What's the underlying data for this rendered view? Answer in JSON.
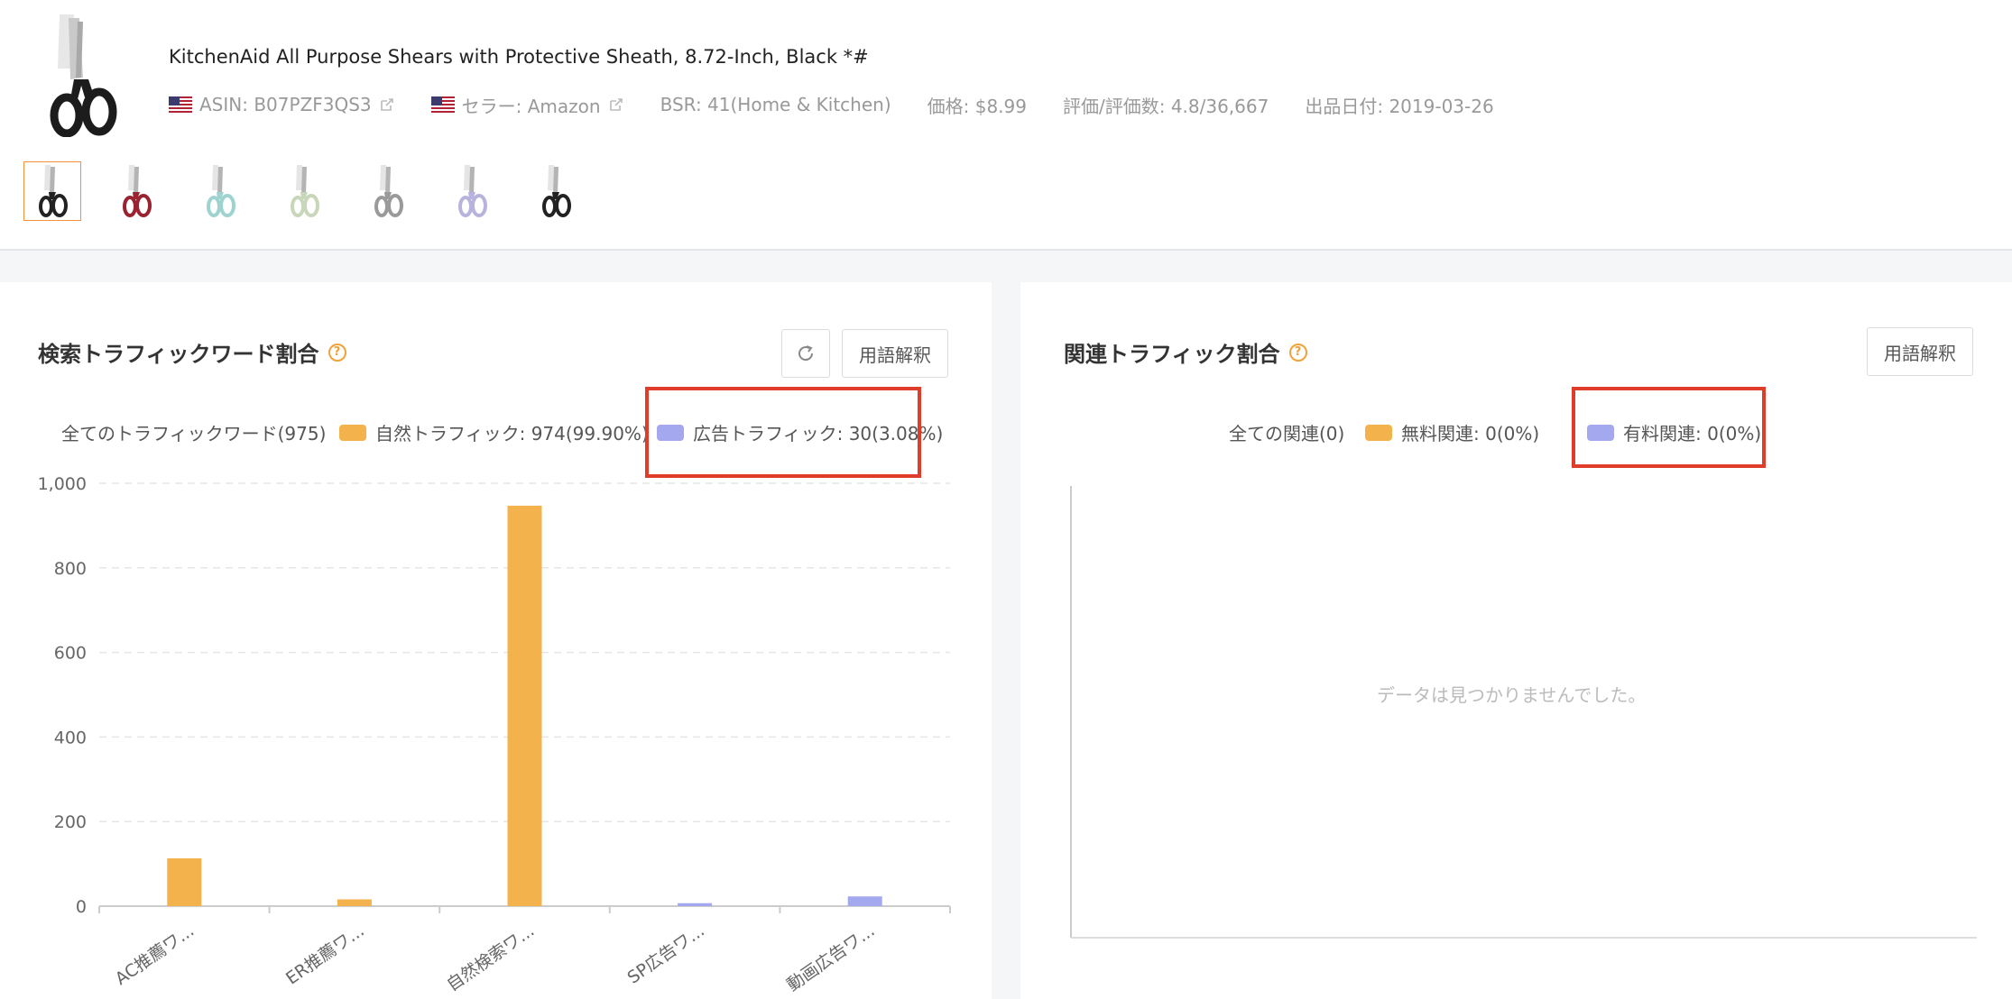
{
  "product": {
    "title": "KitchenAid All Purpose Shears with Protective Sheath, 8.72-Inch, Black *#",
    "asin": "ASIN: B07PZF3QS3",
    "seller": "セラー: Amazon",
    "bsr": "BSR: 41(Home & Kitchen)",
    "price": "価格: $8.99",
    "rating": "評価/評価数: 4.8/36,667",
    "listing_date": "出品日付: 2019-03-26",
    "thumbnail_handle_colors": [
      "#222222",
      "#9b2230",
      "#9fd3cf",
      "#c8d6b9",
      "#9a9a9a",
      "#b7b3dc",
      "#222222"
    ]
  },
  "left_panel": {
    "title": "検索トラフィックワード割合",
    "refresh_icon": "refresh-icon",
    "glossary_label": "用語解釈",
    "legend_all": "全てのトラフィックワード(975)",
    "legend_organic": "自然トラフィック: 974(99.90%)",
    "legend_ads": "広告トラフィック: 30(3.08%)"
  },
  "right_panel": {
    "title": "関連トラフィック割合",
    "glossary_label": "用語解釈",
    "legend_all": "全ての関連(0)",
    "legend_free": "無料関連: 0(0%)",
    "legend_paid": "有料関連: 0(0%)",
    "empty_message": "データは見つかりませんでした。"
  },
  "colors": {
    "organic": "#f3b24b",
    "ads": "#a3a8ef",
    "highlight": "#e03c2a",
    "accent": "#f0a23a"
  },
  "chart_data": {
    "type": "bar",
    "categories": [
      "AC推薦ワ...",
      "ER推薦ワ...",
      "自然検索ワ...",
      "SP広告ワ...",
      "動画広告ワ..."
    ],
    "series": [
      {
        "name": "自然トラフィック",
        "values": [
          113,
          16,
          947,
          0,
          0
        ],
        "color": "#f3b24b"
      },
      {
        "name": "広告トラフィック",
        "values": [
          0,
          0,
          0,
          7,
          23
        ],
        "color": "#a3a8ef"
      }
    ],
    "ylim": [
      0,
      1000
    ],
    "yticks": [
      "0",
      "200",
      "400",
      "600",
      "800",
      "1,000"
    ],
    "grid": true
  }
}
